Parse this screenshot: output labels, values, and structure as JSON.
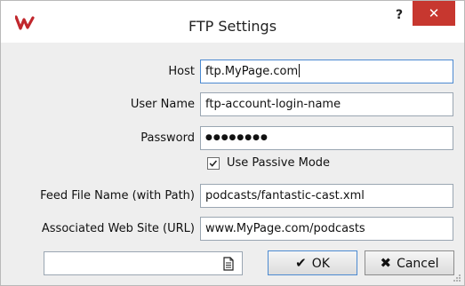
{
  "window": {
    "title": "FTP Settings",
    "help_label": "?",
    "close_label": "✕"
  },
  "form": {
    "host_label": "Host",
    "host_value": "ftp.MyPage.com",
    "user_label": "User Name",
    "user_value": "ftp-account-login-name",
    "password_label": "Password",
    "password_masked": "●●●●●●●●",
    "passive_label": "Use Passive Mode",
    "passive_checked": true,
    "feed_label": "Feed File Name (with Path)",
    "feed_value": "podcasts/fantastic-cast.xml",
    "site_label": "Associated Web Site (URL)",
    "site_value": "www.MyPage.com/podcasts"
  },
  "footer": {
    "file_value": "",
    "ok_label": "OK",
    "ok_glyph": "✔",
    "cancel_label": "Cancel",
    "cancel_glyph": "✖"
  },
  "colors": {
    "close_red": "#c7372f",
    "focus_blue": "#4c8ad1",
    "app_icon_red": "#c1272d"
  },
  "icons": {
    "app": "waveform-logo-icon",
    "file": "document-icon"
  }
}
